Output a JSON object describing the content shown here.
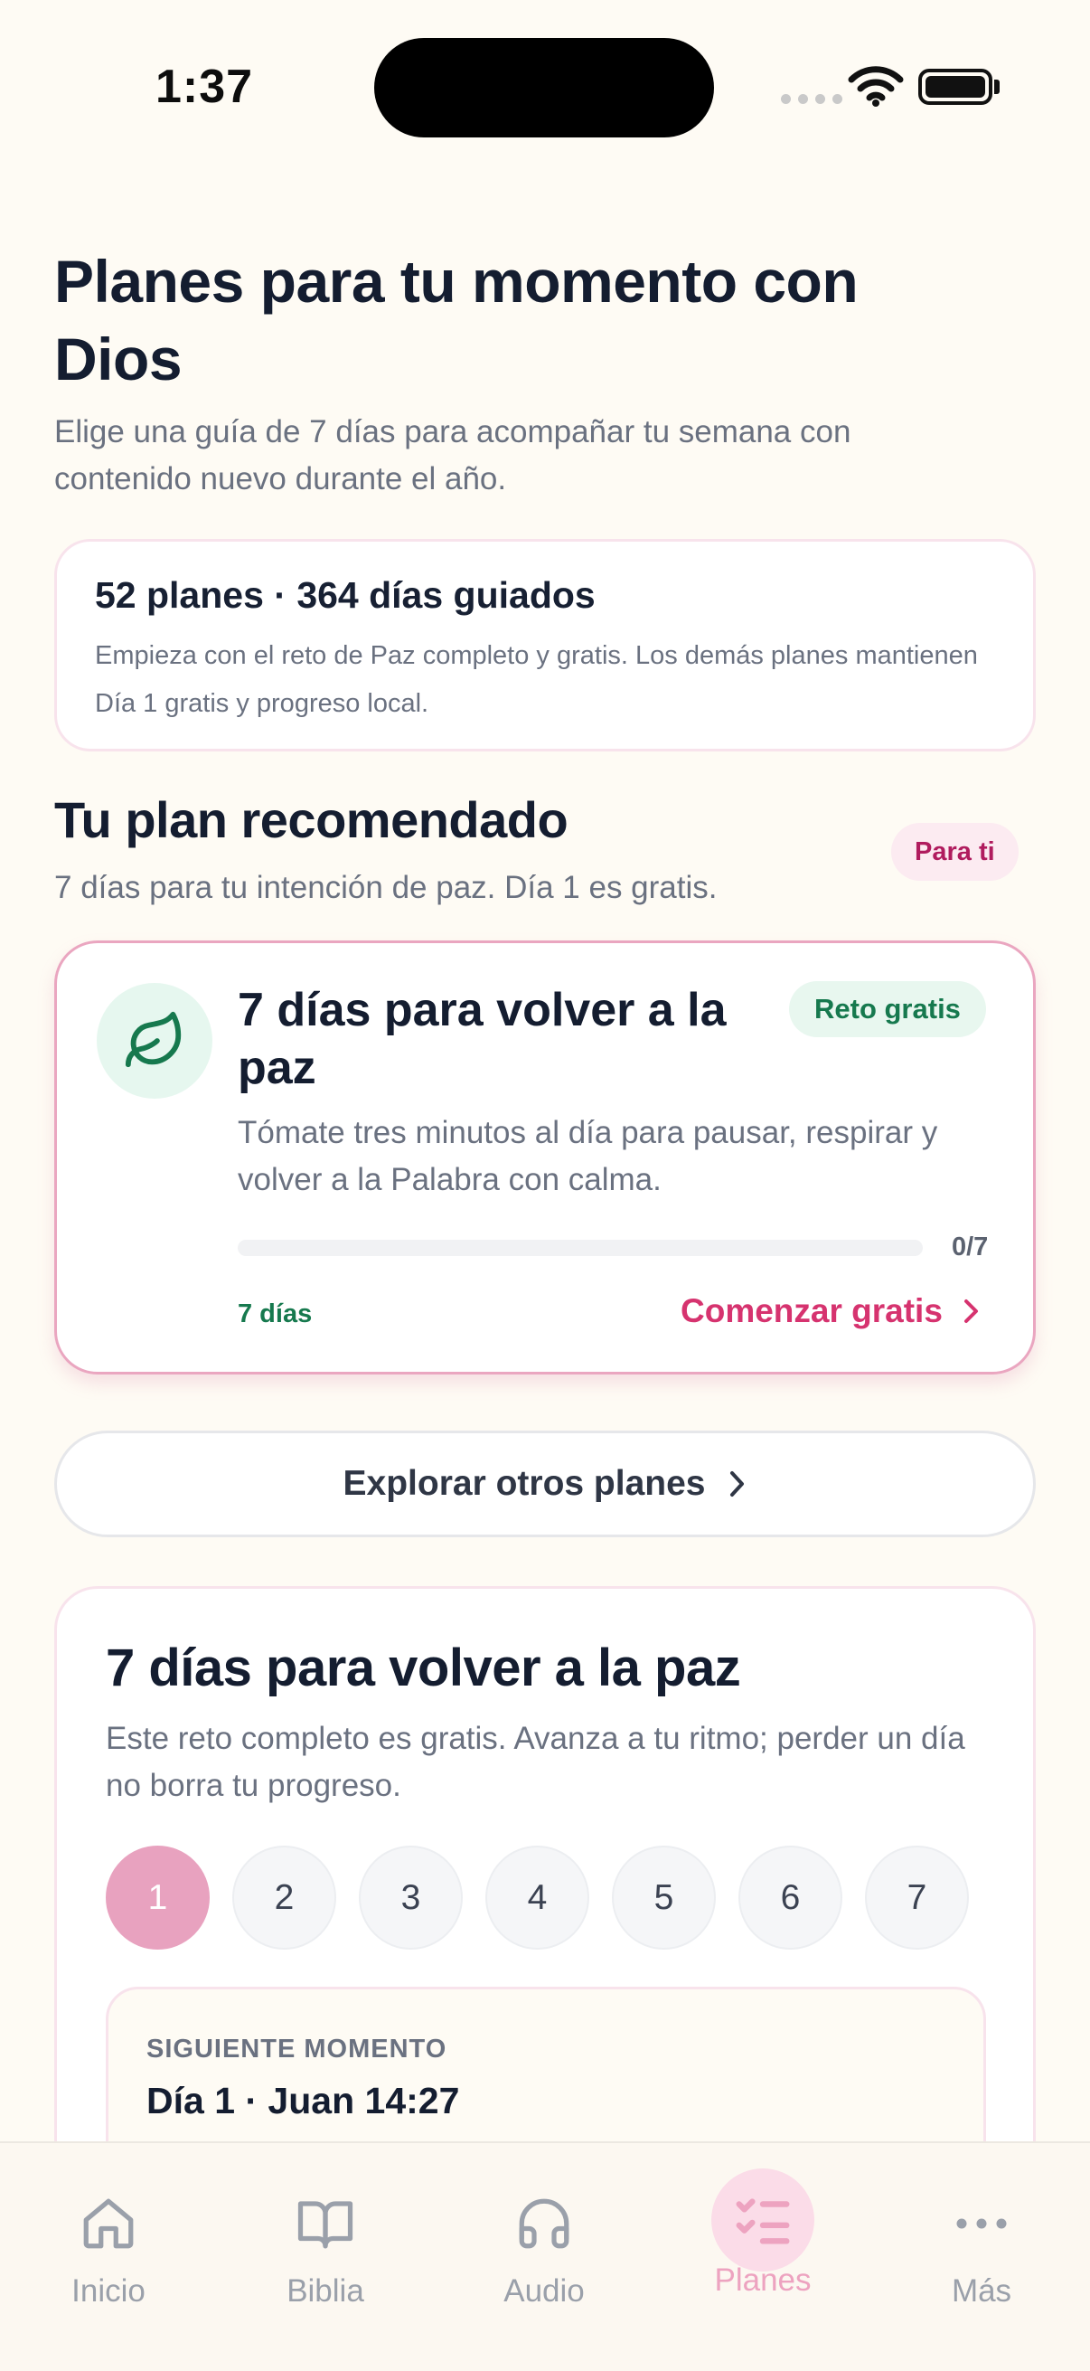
{
  "status_bar": {
    "time": "1:37"
  },
  "header": {
    "title": "Planes para tu momento con Dios",
    "subtitle": "Elige una guía de 7 días para acompañar tu semana con contenido nuevo durante el año."
  },
  "summary": {
    "title": "52 planes · 364 días guiados",
    "text": "Empieza con el reto de Paz completo y gratis. Los demás planes mantienen Día 1 gratis y progreso local."
  },
  "recommended": {
    "title": "Tu plan recomendado",
    "subtitle": "7 días para tu intención de paz. Día 1 es gratis.",
    "badge": "Para ti",
    "card": {
      "icon": "leaf-icon",
      "name": "7 días para volver a la paz",
      "badge": "Reto gratis",
      "description": "Tómate tres minutos al día para pausar, respirar y volver a la Palabra con calma.",
      "progress_text": "0/7",
      "progress_fraction": 0,
      "duration": "7 días",
      "cta": "Comenzar gratis"
    }
  },
  "explore": {
    "label": "Explorar otros planes"
  },
  "detail": {
    "title": "7 días para volver a la paz",
    "description": "Este reto completo es gratis. Avanza a tu ritmo; perder un día no borra tu progreso.",
    "days": [
      "1",
      "2",
      "3",
      "4",
      "5",
      "6",
      "7"
    ],
    "active_day": "1",
    "next": {
      "label": "SIGUIENTE MOMENTO",
      "reference": "Día 1 · Juan 14:27"
    }
  },
  "tabs": [
    {
      "label": "Inicio",
      "icon": "home-icon"
    },
    {
      "label": "Biblia",
      "icon": "book-icon"
    },
    {
      "label": "Audio",
      "icon": "headphones-icon"
    },
    {
      "label": "Planes",
      "icon": "checklist-icon",
      "active": true
    },
    {
      "label": "Más",
      "icon": "more-icon"
    }
  ],
  "colors": {
    "background": "#fefbf4",
    "accent": "#d6336f",
    "green": "#16794e"
  }
}
